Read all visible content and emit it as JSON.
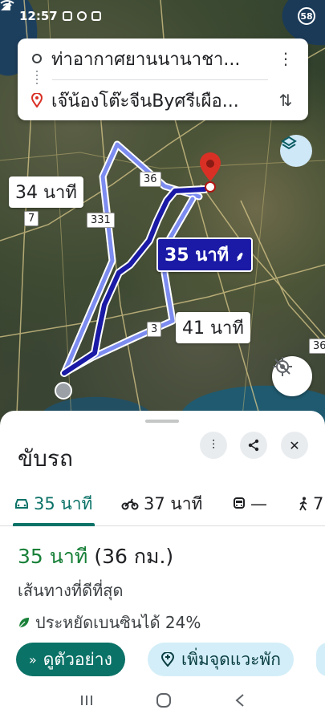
{
  "status_bar": {
    "time": "12:57",
    "battery": "58"
  },
  "search": {
    "origin": "ท่าอากาศยานนานาชา...",
    "destination": "เจ๊น้องโต๊ะจีนByศรีเผือ..."
  },
  "map": {
    "route_labels": {
      "alt1": "34 นาที",
      "selected": "35 นาที",
      "alt2": "41 นาที"
    },
    "road_shields": [
      "36",
      "7",
      "331",
      "3",
      "36"
    ]
  },
  "sheet": {
    "title": "ขับรถ",
    "modes": [
      {
        "icon": "car-icon",
        "label": "35 นาที"
      },
      {
        "icon": "motorcycle-icon",
        "label": "37 นาที"
      },
      {
        "icon": "transit-icon",
        "label": "—"
      },
      {
        "icon": "walk-icon",
        "label": "7"
      }
    ],
    "summary_time": "35 นาที",
    "summary_distance": "(36 กม.)",
    "route_desc": "เส้นทางที่ดีที่สุด",
    "fuel_saving": "ประหยัดเบนซินได้ 24%",
    "preview_button": "ดูตัวอย่าง",
    "add_stop_button": "เพิ่มจุดแวะพัก"
  },
  "colors": {
    "accent": "#0b7267",
    "route_selected": "#1a1aa6",
    "route_alt": "#7d8cf0",
    "summary_green": "#188038",
    "pin_red": "#d93025"
  }
}
